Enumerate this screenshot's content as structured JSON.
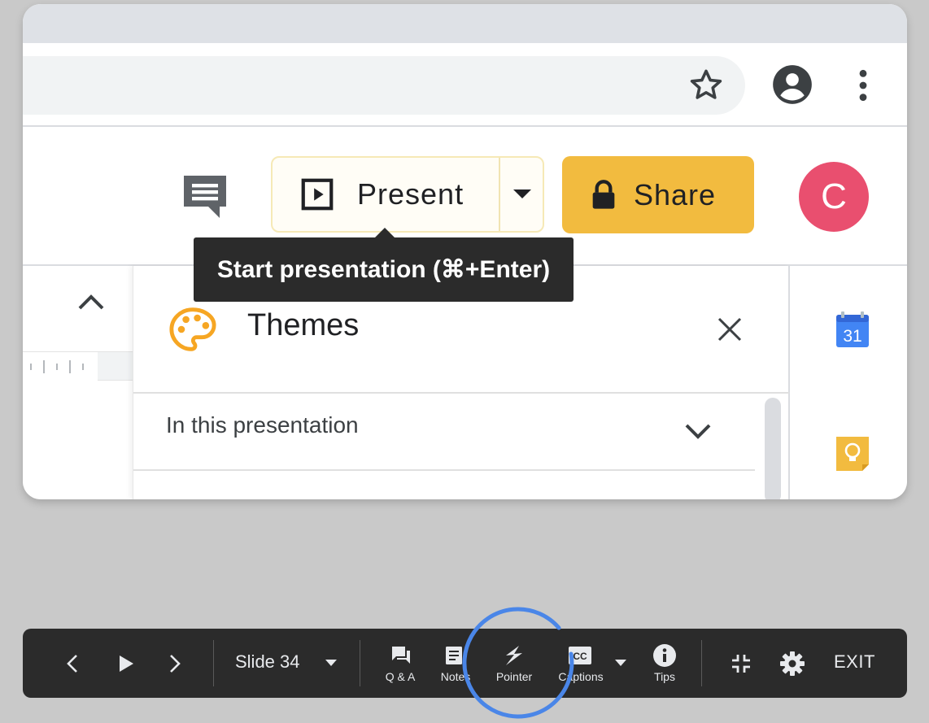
{
  "header": {
    "present_label": "Present",
    "share_label": "Share",
    "avatar_initial": "C"
  },
  "tooltip": {
    "text": "Start presentation (⌘+Enter)"
  },
  "themes_panel": {
    "title": "Themes",
    "section_label": "In this presentation"
  },
  "side_rail": {
    "calendar_day": "31"
  },
  "presenter_toolbar": {
    "slide_label": "Slide 34",
    "qa_label": "Q & A",
    "notes_label": "Notes",
    "pointer_label": "Pointer",
    "captions_label": "Captions",
    "tips_label": "Tips",
    "exit_label": "EXIT"
  },
  "colors": {
    "share_button": "#f2bb3f",
    "avatar": "#e94f6f",
    "highlight_ring": "#4a86e8",
    "toolbar_bg": "#2b2b2b"
  }
}
